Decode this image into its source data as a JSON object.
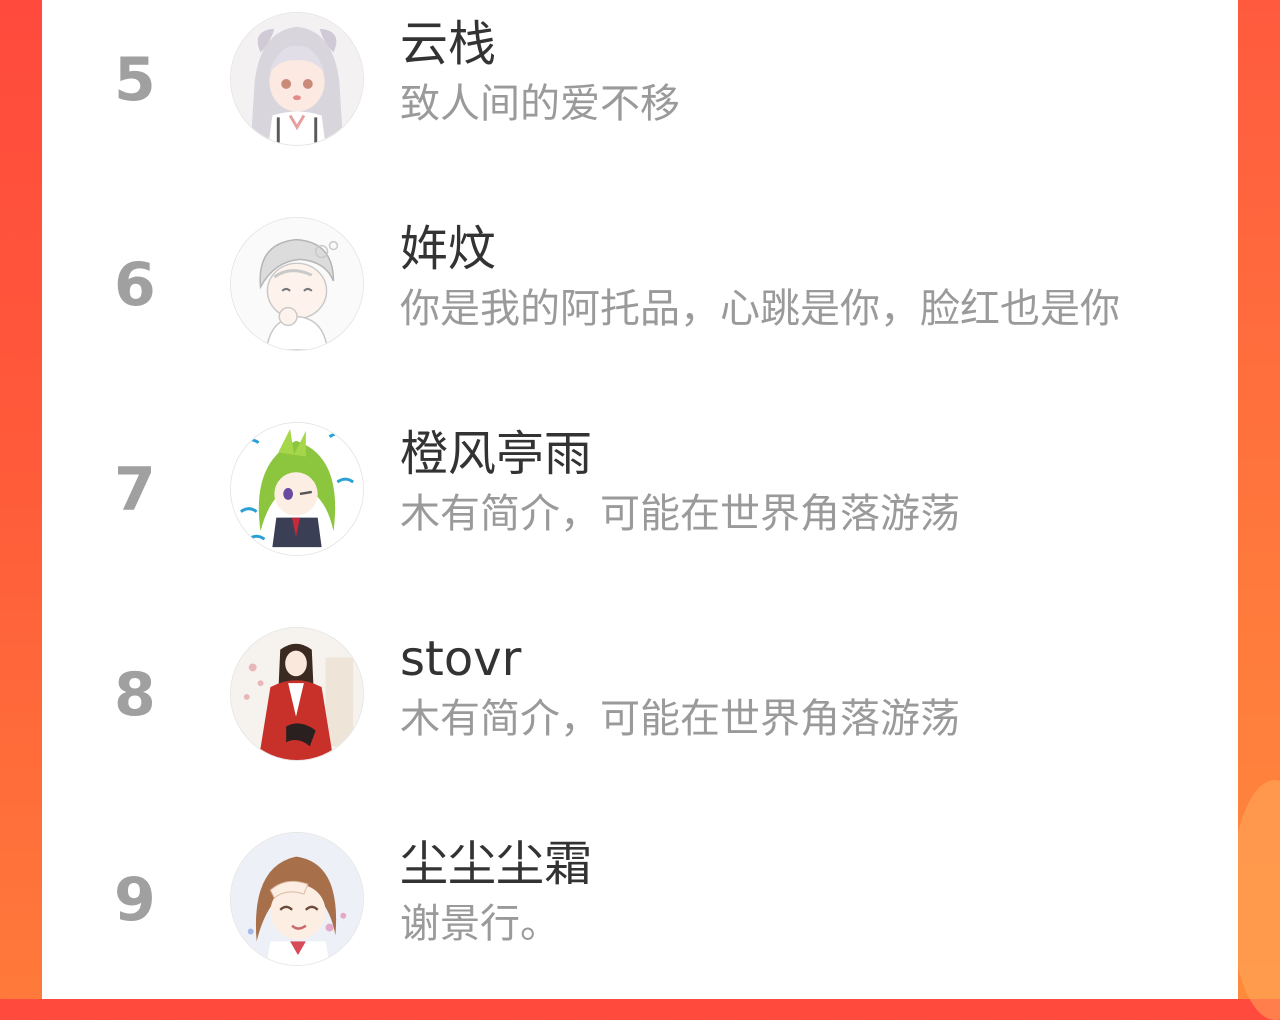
{
  "ranking": {
    "items": [
      {
        "rank": "5",
        "name": "云栈",
        "bio": "致人间的爱不移",
        "avatar_icon": "anime-girl-avatar-icon"
      },
      {
        "rank": "6",
        "name": "姩炆",
        "bio": "你是我的阿托品，心跳是你，脸红也是你",
        "avatar_icon": "anime-boy-avatar-icon"
      },
      {
        "rank": "7",
        "name": "橙风亭雨",
        "bio": "木有简介，可能在世界角落游荡",
        "avatar_icon": "anime-green-hair-avatar-icon"
      },
      {
        "rank": "8",
        "name": "stovr",
        "bio": "木有简介，可能在世界角落游荡",
        "avatar_icon": "ancient-costume-avatar-icon"
      },
      {
        "rank": "9",
        "name": "尘尘尘霜",
        "bio": "谢景行。",
        "avatar_icon": "anime-cheerful-girl-avatar-icon"
      }
    ]
  },
  "colors": {
    "background_red": "#ff4a3d",
    "background_orange": "#ff7a3a",
    "rank_number": "#a0a0a0",
    "name_text": "#333333",
    "bio_text": "#9a9a9a"
  }
}
